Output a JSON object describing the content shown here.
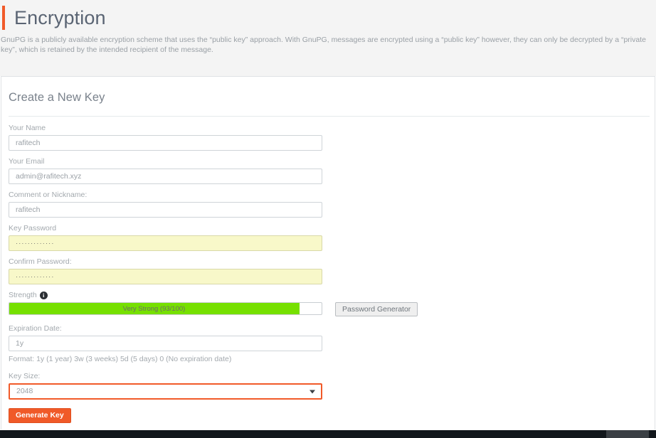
{
  "header": {
    "title": "Encryption",
    "accent_color": "#f15a29",
    "description": "GnuPG is a publicly available encryption scheme that uses the “public key” approach. With GnuPG, messages are encrypted using a “public key” however, they can only be decrypted by a “private key”, which is retained by the intended recipient of the message."
  },
  "panel": {
    "heading": "Create a New Key"
  },
  "form": {
    "name": {
      "label": "Your Name",
      "value": "rafitech"
    },
    "email": {
      "label": "Your Email",
      "value": "admin@rafitech.xyz"
    },
    "comment": {
      "label": "Comment or Nickname:",
      "value": "rafitech"
    },
    "password": {
      "label": "Key Password",
      "value": "·············"
    },
    "confirm_password": {
      "label": "Confirm Password:",
      "value": "·············"
    },
    "strength": {
      "label": "Strength",
      "info_icon": "info-icon",
      "text": "Very Strong (93/100)",
      "score": 93,
      "max": 100,
      "fill_percent": 93,
      "fill_color": "#76e000",
      "generator_button": "Password Generator"
    },
    "expiration": {
      "label": "Expiration Date:",
      "value": "1y",
      "help": "Format: 1y (1 year) 3w (3 weeks) 5d (5 days) 0 (No expiration date)"
    },
    "key_size": {
      "label": "Key Size:",
      "value": "2048",
      "focus_color": "#f15a29",
      "arrow_icon": "chevron-down-icon"
    },
    "submit": {
      "label": "Generate Key",
      "color": "#f05a28"
    }
  }
}
